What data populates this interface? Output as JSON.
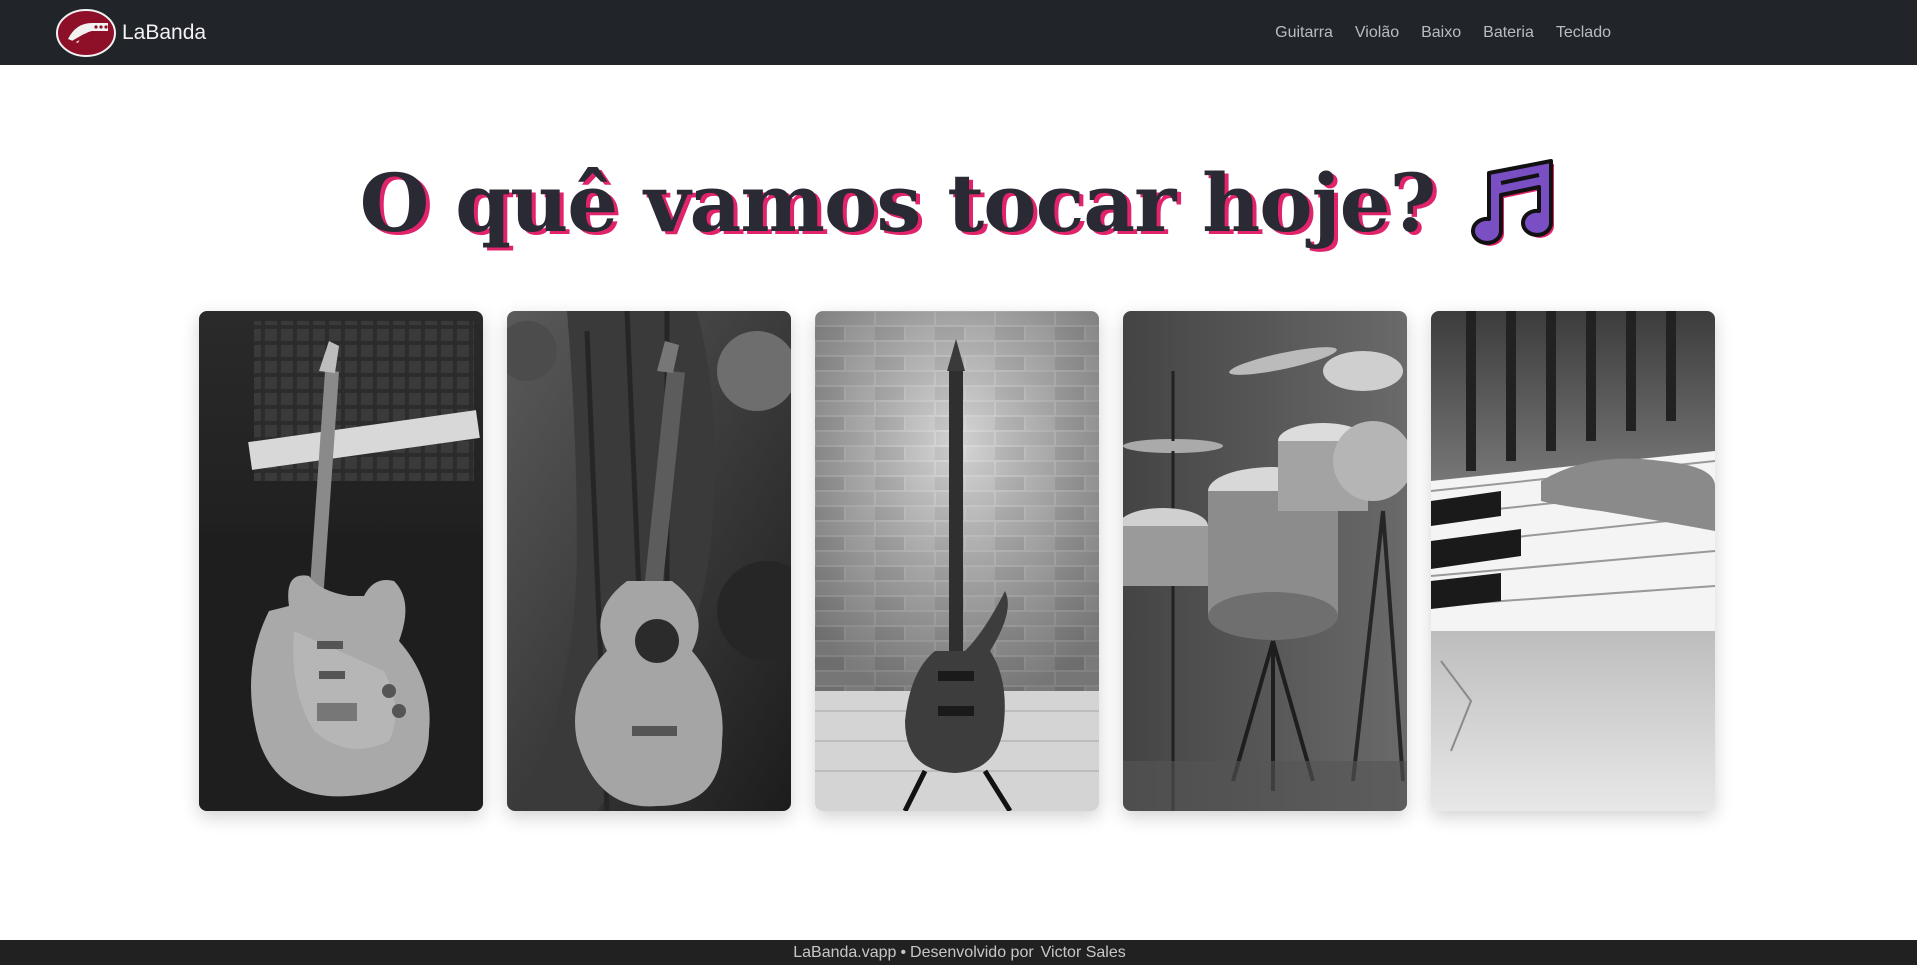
{
  "navbar": {
    "brand_name": "LaBanda",
    "links": [
      "Guitarra",
      "Violão",
      "Baixo",
      "Bateria",
      "Teclado"
    ]
  },
  "hero": {
    "title": "O quê vamos tocar hoje?",
    "icon": "music-notes-icon",
    "title_shadow_color": "#e0236a",
    "icon_color": "#7a4fc4"
  },
  "cards": [
    {
      "instrument": "Guitarra",
      "image": "electric-guitar-photo"
    },
    {
      "instrument": "Violão",
      "image": "acoustic-guitar-photo"
    },
    {
      "instrument": "Baixo",
      "image": "bass-guitar-photo"
    },
    {
      "instrument": "Bateria",
      "image": "drum-kit-photo"
    },
    {
      "instrument": "Teclado",
      "image": "piano-keys-photo"
    }
  ],
  "footer": {
    "site": "LaBanda.vapp",
    "separator": "•",
    "credit_prefix": "Desenvolvido por",
    "author": "Victor Sales"
  },
  "colors": {
    "navbar_bg": "#212529",
    "footer_bg": "#212121",
    "logo_red": "#8e1028"
  }
}
